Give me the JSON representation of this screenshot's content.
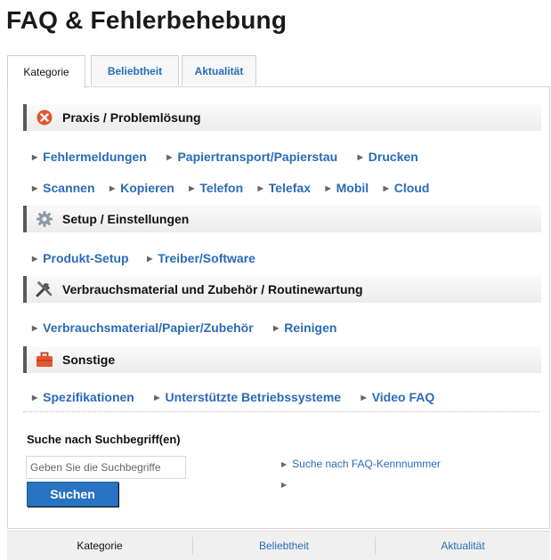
{
  "page": {
    "title": "FAQ & Fehlerbehebung"
  },
  "tabs": [
    {
      "label": "Kategorie"
    },
    {
      "label": "Beliebtheit"
    },
    {
      "label": "Aktualität"
    }
  ],
  "sections": [
    {
      "label": "Praxis / Problemlösung",
      "icon": "error-x-icon",
      "rows": [
        [
          "Fehlermeldungen",
          "Papiertransport/Papierstau",
          "Drucken"
        ],
        [
          "Scannen",
          "Kopieren",
          "Telefon",
          "Telefax",
          "Mobil",
          "Cloud"
        ]
      ]
    },
    {
      "label": "Setup / Einstellungen",
      "icon": "gear-icon",
      "rows": [
        [
          "Produkt-Setup",
          "Treiber/Software"
        ]
      ]
    },
    {
      "label": "Verbrauchsmaterial und Zubehör / Routinewartung",
      "icon": "tools-icon",
      "rows": [
        [
          "Verbrauchsmaterial/Papier/Zubehör",
          "Reinigen"
        ]
      ]
    },
    {
      "label": "Sonstige",
      "icon": "toolbox-icon",
      "rows": [
        [
          "Spezifikationen",
          "Unterstützte Betriebssysteme",
          "Video FAQ"
        ]
      ]
    }
  ],
  "search": {
    "title": "Suche nach Suchbegriff(en)",
    "placeholder": "Geben Sie die Suchbegriffe",
    "button_label": "Suchen",
    "faq_number_link": "Suche nach FAQ-Kennnummer"
  },
  "bottom_tabs": [
    {
      "label": "Kategorie"
    },
    {
      "label": "Beliebtheit"
    },
    {
      "label": "Aktualität"
    }
  ],
  "colors": {
    "link": "#2a6bb8",
    "button": "#2a73c2",
    "error_icon": "#e2552e",
    "toolbox_icon": "#e4572e"
  }
}
